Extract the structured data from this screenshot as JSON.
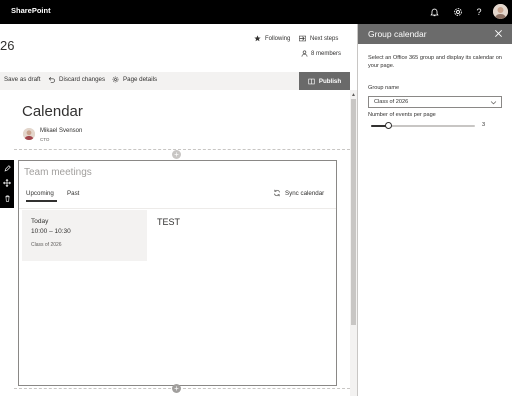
{
  "suite": {
    "brand": "SharePoint",
    "icons": [
      "bell-icon",
      "gear-icon",
      "help-icon",
      "avatar"
    ],
    "help_label": "?"
  },
  "site": {
    "number_fragment": "26",
    "following_label": "Following",
    "next_steps_label": "Next steps",
    "members_label": "8 members"
  },
  "command_bar": {
    "save_draft_label": "Save as draft",
    "discard_label": "Discard changes",
    "page_details_label": "Page details",
    "publish_label": "Publish"
  },
  "page": {
    "title": "Calendar",
    "author_name": "Mikael Svenson",
    "author_role": "CTO"
  },
  "edit_toolbar": {
    "icons": [
      "edit-icon",
      "move-icon",
      "delete-icon"
    ]
  },
  "webpart": {
    "title_placeholder": "Team meetings",
    "tabs": [
      {
        "label": "Upcoming",
        "selected": true
      },
      {
        "label": "Past",
        "selected": false
      }
    ],
    "sync_label": "Sync calendar",
    "event": {
      "day": "Today",
      "time": "10:00 – 10:30",
      "group": "Class of 2026",
      "title": "TEST"
    }
  },
  "pane": {
    "title": "Group calendar",
    "description": "Select an Office 365 group and display its calendar on your page.",
    "group_name_label": "Group name",
    "group_name_value": "Class of 2026",
    "events_per_page_label": "Number of events per page",
    "events_per_page_value": "3",
    "events_per_page_fraction": 0.17
  },
  "colors": {
    "suite_bar": "#000000",
    "pane_header": "#6b6b6b",
    "publish_button": "#6a6a6a",
    "command_bar": "#f3f2f1"
  }
}
